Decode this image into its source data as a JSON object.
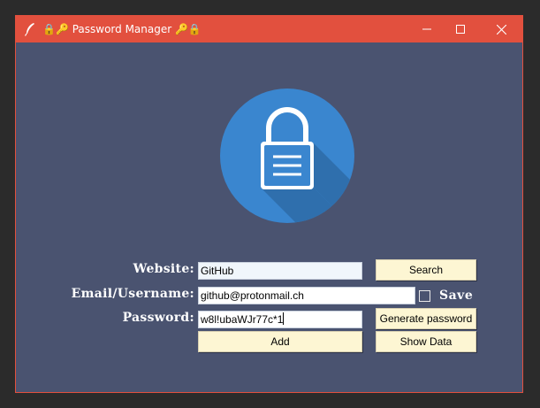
{
  "window": {
    "title": "🔒🔑 Password Manager 🔑🔒",
    "accent": "#e2503e",
    "background": "#4a5370"
  },
  "titlebar_icons": [
    "feather-icon",
    "minimize-icon",
    "maximize-icon",
    "close-icon"
  ],
  "logo": {
    "icon": "padlock-icon",
    "circle_color": "#3a86cf"
  },
  "form": {
    "website_label": "Website:",
    "website_value": "GitHub",
    "email_label": "Email/Username:",
    "email_value": "github@protonmail.ch",
    "password_label": "Password:",
    "password_value": "w8l!ubaWJr77c*1",
    "save_label": "Save",
    "save_checked": false
  },
  "buttons": {
    "search": "Search",
    "generate": "Generate password",
    "add": "Add",
    "show": "Show Data",
    "color": "#fdf6d3"
  }
}
